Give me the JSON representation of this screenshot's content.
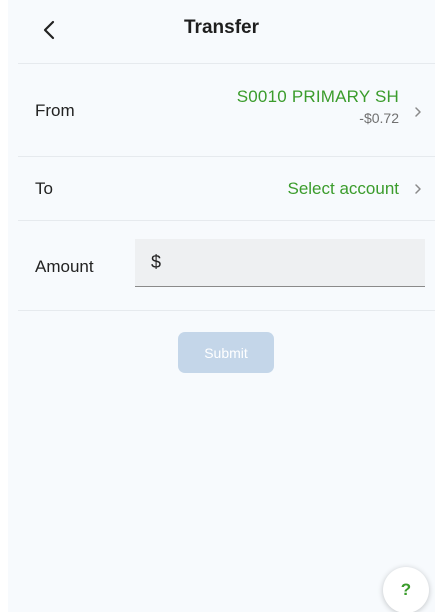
{
  "header": {
    "title": "Transfer",
    "back_icon": "chevron-left-icon"
  },
  "from": {
    "label": "From",
    "account_name": "S0010 PRIMARY SH",
    "balance": "-$0.72"
  },
  "to": {
    "label": "To",
    "placeholder": "Select account"
  },
  "amount": {
    "label": "Amount",
    "currency_symbol": "$",
    "value": ""
  },
  "submit": {
    "label": "Submit",
    "disabled": true
  },
  "help": {
    "label": "?"
  },
  "colors": {
    "accent": "#3b9c2c",
    "background": "#f7fafd",
    "submit_disabled": "#c4d6e9",
    "divider": "#e6eaee",
    "input_bg": "#eef0f2"
  }
}
